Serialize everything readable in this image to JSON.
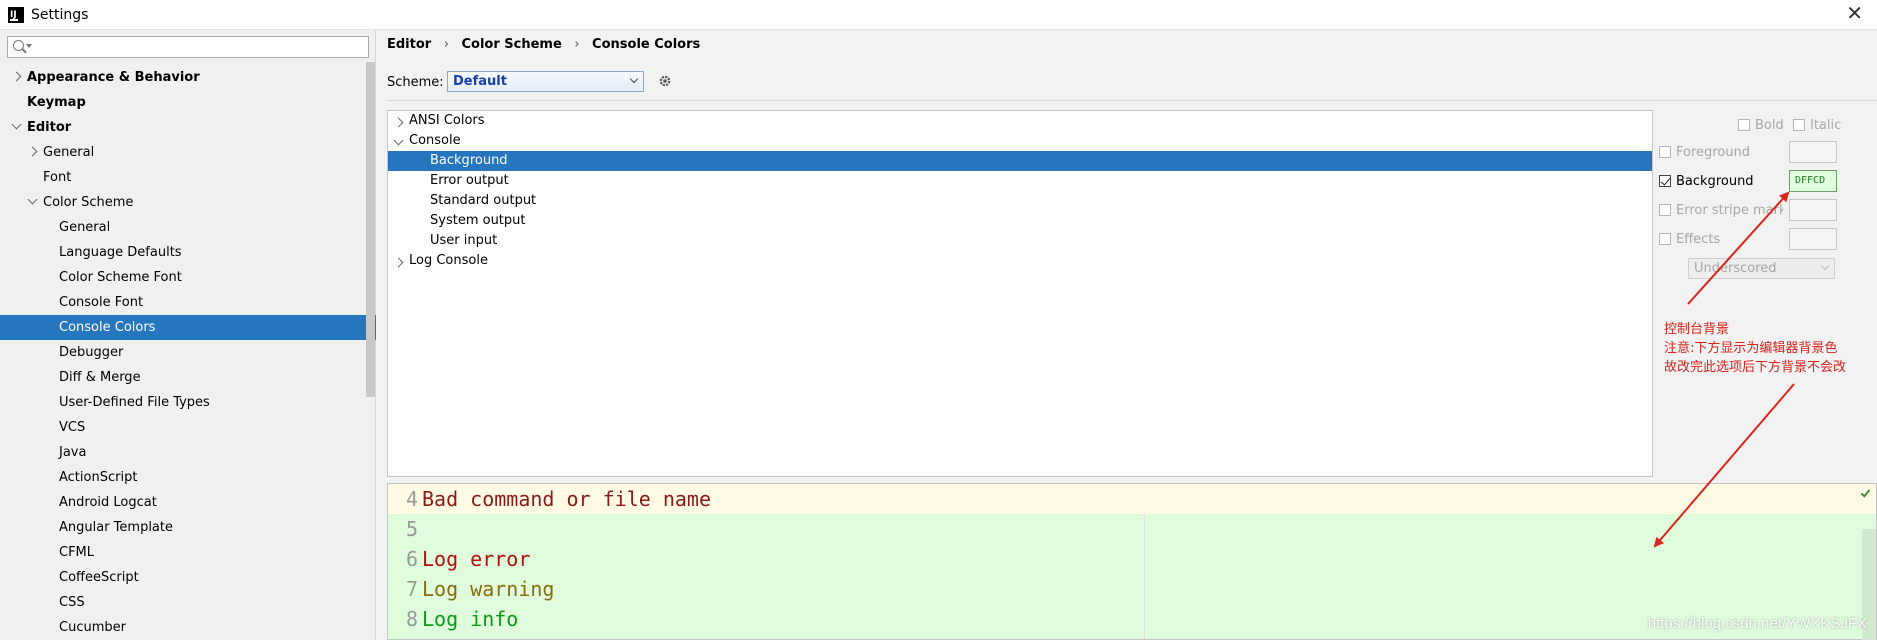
{
  "window": {
    "title": "Settings"
  },
  "search": {
    "placeholder": ""
  },
  "sidebar": {
    "items": [
      {
        "label": "Appearance & Behavior",
        "level": 0,
        "bold": true,
        "arrow": "right"
      },
      {
        "label": "Keymap",
        "level": 0,
        "bold": true,
        "arrow": "none"
      },
      {
        "label": "Editor",
        "level": 0,
        "bold": true,
        "arrow": "down"
      },
      {
        "label": "General",
        "level": 1,
        "arrow": "right"
      },
      {
        "label": "Font",
        "level": 1,
        "arrow": "none"
      },
      {
        "label": "Color Scheme",
        "level": 1,
        "arrow": "down"
      },
      {
        "label": "General",
        "level": 2,
        "arrow": "none"
      },
      {
        "label": "Language Defaults",
        "level": 2,
        "arrow": "none"
      },
      {
        "label": "Color Scheme Font",
        "level": 2,
        "arrow": "none"
      },
      {
        "label": "Console Font",
        "level": 2,
        "arrow": "none"
      },
      {
        "label": "Console Colors",
        "level": 2,
        "arrow": "none",
        "selected": true
      },
      {
        "label": "Debugger",
        "level": 2,
        "arrow": "none"
      },
      {
        "label": "Diff & Merge",
        "level": 2,
        "arrow": "none"
      },
      {
        "label": "User-Defined File Types",
        "level": 2,
        "arrow": "none"
      },
      {
        "label": "VCS",
        "level": 2,
        "arrow": "none"
      },
      {
        "label": "Java",
        "level": 2,
        "arrow": "none"
      },
      {
        "label": "ActionScript",
        "level": 2,
        "arrow": "none"
      },
      {
        "label": "Android Logcat",
        "level": 2,
        "arrow": "none"
      },
      {
        "label": "Angular Template",
        "level": 2,
        "arrow": "none"
      },
      {
        "label": "CFML",
        "level": 2,
        "arrow": "none"
      },
      {
        "label": "CoffeeScript",
        "level": 2,
        "arrow": "none"
      },
      {
        "label": "CSS",
        "level": 2,
        "arrow": "none"
      },
      {
        "label": "Cucumber",
        "level": 2,
        "arrow": "none"
      }
    ]
  },
  "breadcrumb": {
    "part1": "Editor",
    "part2": "Color Scheme",
    "part3": "Console Colors",
    "separator": "›"
  },
  "scheme": {
    "label": "Scheme:",
    "value": "Default"
  },
  "attributes": {
    "items": [
      {
        "label": "ANSI Colors",
        "level": 0,
        "arrow": "right"
      },
      {
        "label": "Console",
        "level": 0,
        "arrow": "down"
      },
      {
        "label": "Background",
        "level": 1,
        "arrow": "none",
        "selected": true
      },
      {
        "label": "Error output",
        "level": 1,
        "arrow": "none"
      },
      {
        "label": "Standard output",
        "level": 1,
        "arrow": "none"
      },
      {
        "label": "System output",
        "level": 1,
        "arrow": "none"
      },
      {
        "label": "User input",
        "level": 1,
        "arrow": "none"
      },
      {
        "label": "Log Console",
        "level": 0,
        "arrow": "right"
      }
    ]
  },
  "options": {
    "bold": "Bold",
    "italic": "Italic",
    "foreground": "Foreground",
    "background": "Background",
    "background_checked": true,
    "background_value": "DFFCD",
    "error_stripe": "Error stripe mark",
    "effects": "Effects",
    "effects_type": "Underscored"
  },
  "annotation": {
    "line1": "控制台背景",
    "line2": "注意:下方显示为编辑器背景色",
    "line3": "故改完此选项后下方背景不会改"
  },
  "preview": {
    "lines": [
      {
        "num": "4",
        "text": "Bad command or file name",
        "color": "#8b1a1a",
        "highlight": true
      },
      {
        "num": "5",
        "text": "",
        "color": "#000000"
      },
      {
        "num": "6",
        "text": "Log error",
        "color": "#b01010"
      },
      {
        "num": "7",
        "text": "Log warning",
        "color": "#8a6d0b"
      },
      {
        "num": "8",
        "text": "Log info",
        "color": "#0d9b15"
      }
    ]
  },
  "watermark": "https://blog.csdn.net/YWXKSJFX",
  "colors": {
    "selection": "#2675bf",
    "preview_background": "#dffcdd",
    "annotation": "#d9241c"
  }
}
